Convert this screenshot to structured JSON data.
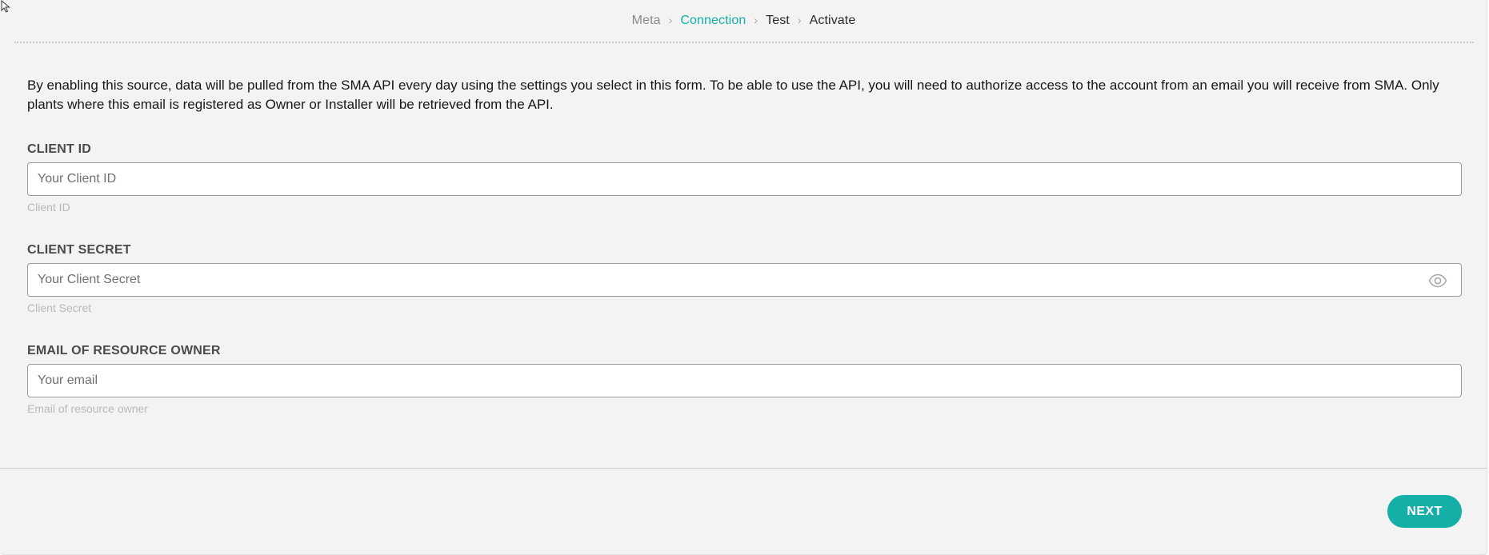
{
  "steps": [
    {
      "label": "Meta",
      "state": "done"
    },
    {
      "label": "Connection",
      "state": "active"
    },
    {
      "label": "Test",
      "state": "pending"
    },
    {
      "label": "Activate",
      "state": "pending"
    }
  ],
  "step_separator": "›",
  "intro": "By enabling this source, data will be pulled from the SMA API every day using the settings you select in this form. To be able to use the API, you will need to authorize access to the account from an email you will receive from SMA. Only plants where this email is registered as Owner or Installer will be retrieved from the API.",
  "fields": {
    "client_id": {
      "label": "CLIENT ID",
      "placeholder": "Your Client ID",
      "value": "",
      "hint": "Client ID"
    },
    "client_secret": {
      "label": "CLIENT SECRET",
      "placeholder": "Your Client Secret",
      "value": "",
      "hint": "Client Secret",
      "toggle_icon": "eye-icon"
    },
    "email": {
      "label": "EMAIL OF RESOURCE OWNER",
      "placeholder": "Your email",
      "value": "",
      "hint": "Email of resource owner"
    }
  },
  "footer": {
    "next_label": "NEXT"
  },
  "colors": {
    "accent": "#14b0a8",
    "panel_bg": "#f3f3f3",
    "hint_text": "#b9b9b9"
  }
}
